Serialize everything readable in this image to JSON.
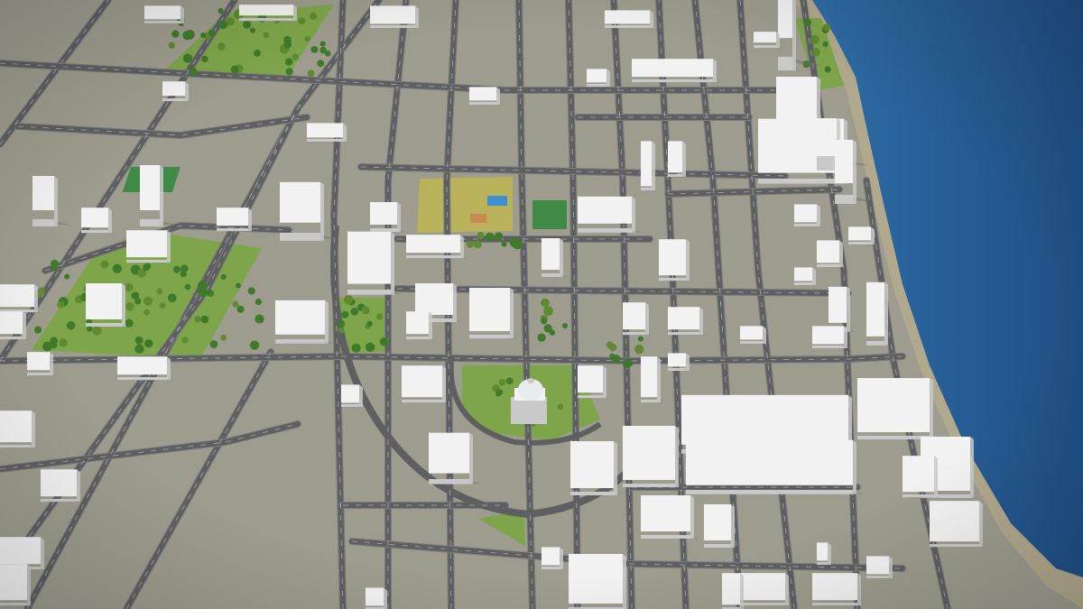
{
  "scene": {
    "kind": "aerial-3d-city-model",
    "colors": {
      "ground": "#9d9c8e",
      "ground_dark": "#8c8b7e",
      "road": "#5e5f61",
      "road_edge": "#7b7c7c",
      "lane_line": "#e9e9e4",
      "grass": "#7ea54a",
      "grass_dark": "#5f8a32",
      "tree": "#3f7a2a",
      "field_yellow": "#b9b25a",
      "pitch_green": "#3e8a46",
      "court_blue": "#3d8fd0",
      "court_orange": "#c98a4f",
      "sand": "#b1a98d",
      "water": "#2f6da6",
      "water_deep": "#1f4f86",
      "building_top": "#f2f2f2",
      "building_side": "#c9c9c9",
      "building_shadow": "#6e6e66",
      "dome": "#e8ecee"
    }
  }
}
